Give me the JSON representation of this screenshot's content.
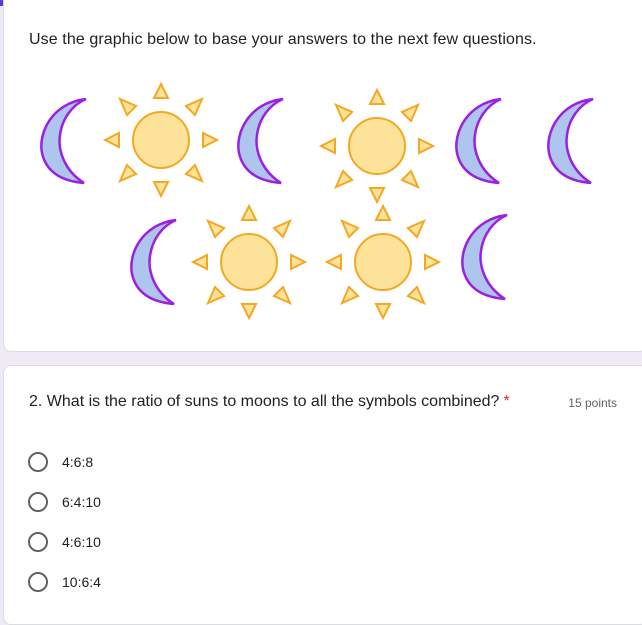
{
  "colors": {
    "accent": "#4b3fe0",
    "required": "#d93025",
    "sun_fill": "#fde39a",
    "sun_stroke": "#f3a823",
    "moon_fill": "#aec6ee",
    "moon_stroke": "#9b20e0"
  },
  "intro": {
    "text": "Use the graphic below to base your answers to the next few questions."
  },
  "graphic": {
    "row1": [
      "moon",
      "sun",
      "moon",
      "sun",
      "moon",
      "moon"
    ],
    "row2": [
      "moon",
      "sun",
      "sun",
      "moon"
    ]
  },
  "question": {
    "text": "2. What is the ratio of suns to moons to all the symbols combined?",
    "required_mark": "*",
    "points": "15 points",
    "options": [
      {
        "label": "4:6:8"
      },
      {
        "label": "6:4:10"
      },
      {
        "label": "4:6:10"
      },
      {
        "label": "10:6:4"
      }
    ]
  }
}
